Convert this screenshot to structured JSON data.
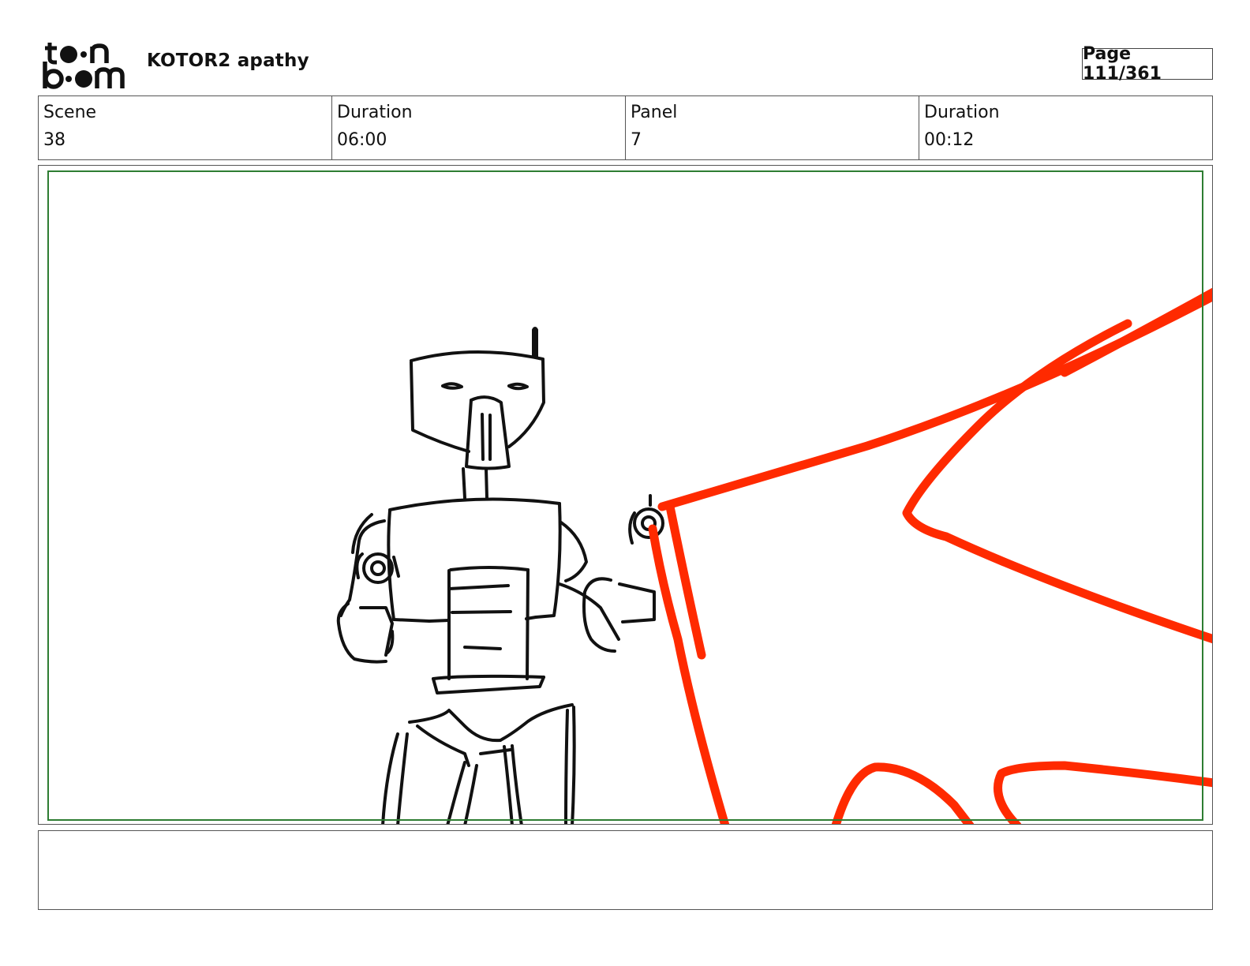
{
  "header": {
    "logo_text_top": "toon",
    "logo_text_bottom": "boom",
    "project_title": "KOTOR2 apathy",
    "page_label": "Page 111/361"
  },
  "info": [
    {
      "label": "Scene",
      "value": "38"
    },
    {
      "label": "Duration",
      "value": "06:00"
    },
    {
      "label": "Panel",
      "value": "7"
    },
    {
      "label": "Duration",
      "value": "00:12"
    }
  ],
  "panel": {
    "drawing": "robot-droid-sketch",
    "effect": "red-blaster-flash",
    "effect_color": "#ff2a00",
    "safe_frame_color": "#2e7d32"
  },
  "notes": {
    "text": ""
  }
}
